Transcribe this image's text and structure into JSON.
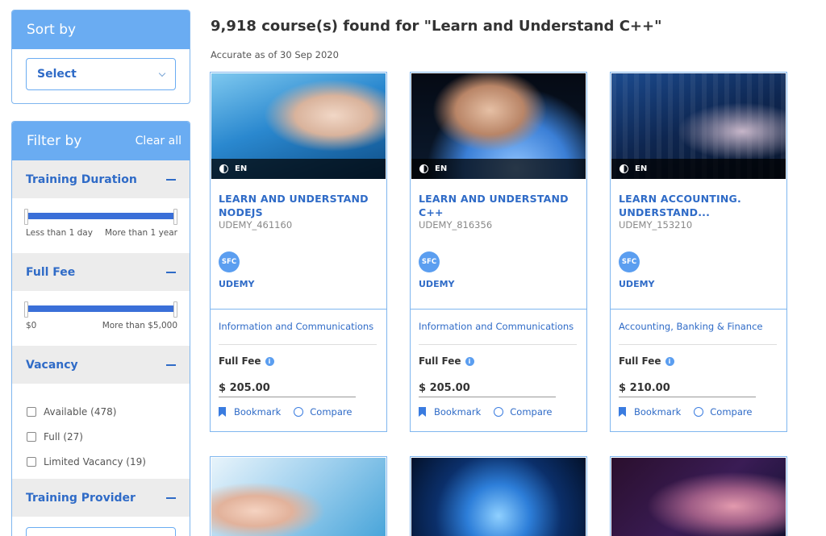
{
  "sort": {
    "title": "Sort by",
    "select_value": "Select"
  },
  "filter": {
    "title": "Filter by",
    "clear_label": "Clear all",
    "sections": {
      "duration": {
        "title": "Training Duration",
        "min_label": "Less than 1 day",
        "max_label": "More than 1 year"
      },
      "fee": {
        "title": "Full Fee",
        "min_label": "$0",
        "max_label": "More than $5,000"
      },
      "vacancy": {
        "title": "Vacancy",
        "options": [
          "Available (478)",
          "Full (27)",
          "Limited Vacancy (19)"
        ]
      },
      "provider": {
        "title": "Training Provider"
      }
    }
  },
  "results": {
    "title": "9,918 course(s) found for \"Learn and Understand C++\"",
    "accurate_note": "Accurate as of 30 Sep 2020"
  },
  "cards": [
    {
      "lang": "EN",
      "title": "LEARN AND UNDERSTAND NODEJS",
      "code": "UDEMY_461160",
      "badge": "SFC",
      "provider": "UDEMY",
      "category": "Information and Communications",
      "fee_label": "Full Fee",
      "price": "$ 205.00",
      "bookmark_label": "Bookmark",
      "compare_label": "Compare"
    },
    {
      "lang": "EN",
      "title": "LEARN AND UNDERSTAND C++",
      "code": "UDEMY_816356",
      "badge": "SFC",
      "provider": "UDEMY",
      "category": "Information and Communications",
      "fee_label": "Full Fee",
      "price": "$ 205.00",
      "bookmark_label": "Bookmark",
      "compare_label": "Compare"
    },
    {
      "lang": "EN",
      "title": "LEARN ACCOUNTING. UNDERSTAND...",
      "code": "UDEMY_153210",
      "badge": "SFC",
      "provider": "UDEMY",
      "category": "Accounting, Banking & Finance",
      "fee_label": "Full Fee",
      "price": "$ 210.00",
      "bookmark_label": "Bookmark",
      "compare_label": "Compare"
    }
  ]
}
